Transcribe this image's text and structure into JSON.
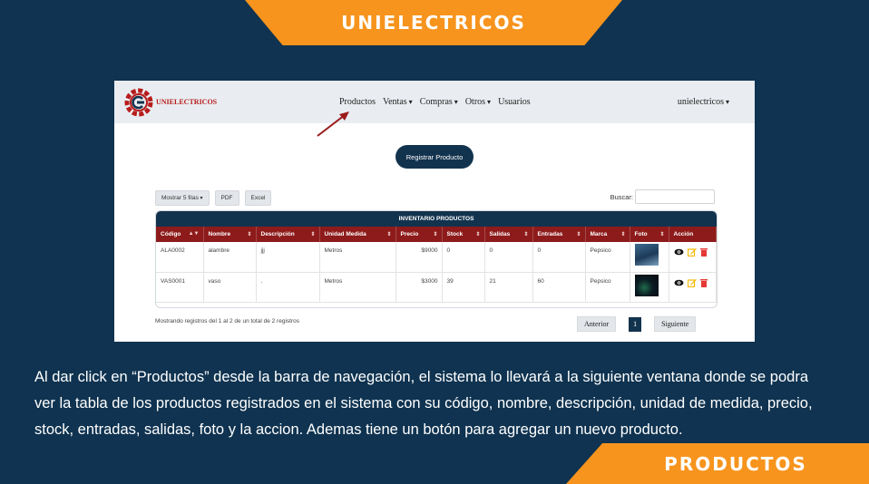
{
  "banners": {
    "top": "UNIELECTRICOS",
    "bottom": "PRODUCTOS"
  },
  "colors": {
    "background": "#0f3350",
    "accent": "#f7941d",
    "navy": "#12334e",
    "header_red": "#8e1b1b"
  },
  "app": {
    "logo_text": "UNIELECTRICOS",
    "nav": [
      {
        "label": "Productos",
        "caret": false
      },
      {
        "label": "Ventas",
        "caret": true
      },
      {
        "label": "Compras",
        "caret": true
      },
      {
        "label": "Otros",
        "caret": true
      },
      {
        "label": "Usuarios",
        "caret": false
      }
    ],
    "user_menu": "unielectricos",
    "register_button": "Registrar Producto",
    "toolbar": {
      "show_rows": "Mostrar 5 filas",
      "pdf": "PDF",
      "excel": "Excel"
    },
    "search_label": "Buscar:",
    "table": {
      "title": "INVENTARIO PRODUCTOS",
      "columns": [
        "Código",
        "Nombre",
        "Descripción",
        "Unidad Medida",
        "Precio",
        "Stock",
        "Salidas",
        "Entradas",
        "Marca",
        "Foto",
        "Acción"
      ],
      "rows": [
        {
          "codigo": "ALA0002",
          "nombre": "alambre",
          "descripcion": "jjj",
          "unidad": "Metros",
          "precio": "$9000",
          "stock": "0",
          "salidas": "0",
          "entradas": "0",
          "marca": "Pepsico",
          "foto": "photo-dark-blue"
        },
        {
          "codigo": "VAS0001",
          "nombre": "vaso",
          "descripcion": ".",
          "unidad": "Metros",
          "precio": "$3000",
          "stock": "39",
          "salidas": "21",
          "entradas": "60",
          "marca": "Pepsico",
          "foto": "photo-dark-black"
        }
      ]
    },
    "footer_info": "Mostrando registros del 1 al 2 de un total de 2 registros",
    "pagination": {
      "prev": "Anterior",
      "page": "1",
      "next": "Siguiente"
    }
  },
  "description": "Al dar click en “Productos” desde la barra de navegación, el sistema lo llevará a la siguiente ventana donde se podra ver la tabla de los productos registrados en el sistema con su código,  nombre, descripción, unidad de medida, precio,  stock, entradas, salidas, foto y la accion.  Ademas tiene un botón para agregar un nuevo producto."
}
